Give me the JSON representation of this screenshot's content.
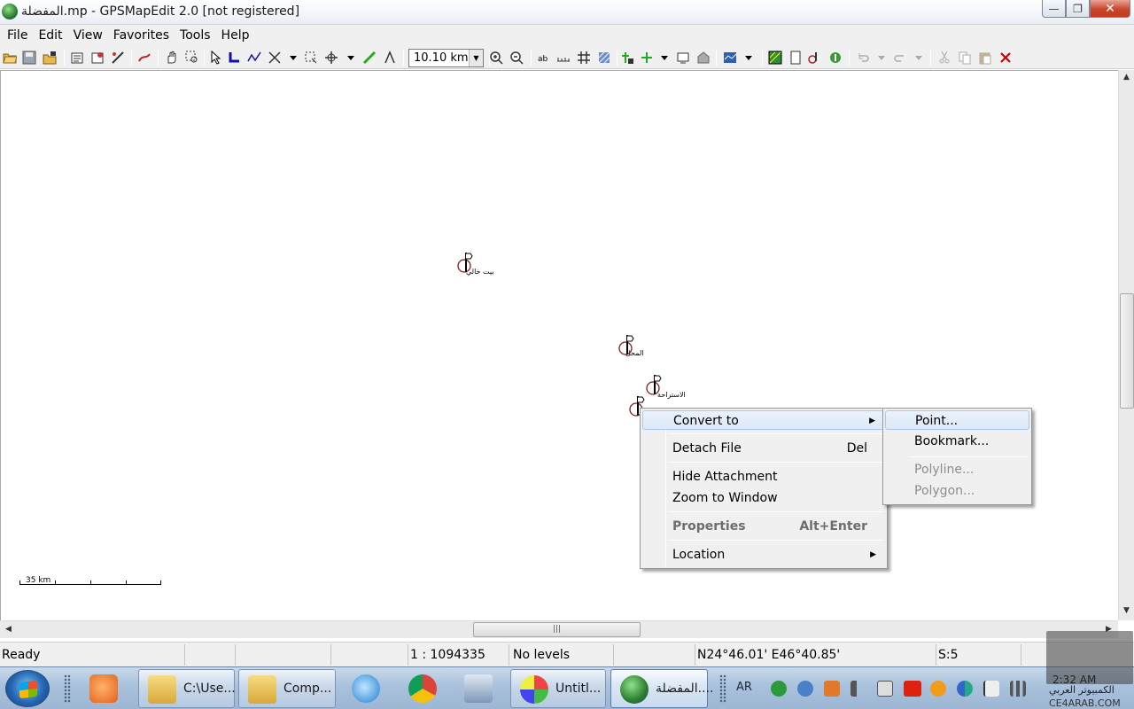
{
  "window": {
    "title": "المفضلة.mp - GPSMapEdit 2.0 [not registered]",
    "controls": {
      "minimize": "—",
      "maximize": "❐",
      "close": "✕"
    }
  },
  "menubar": [
    "File",
    "Edit",
    "View",
    "Favorites",
    "Tools",
    "Help"
  ],
  "toolbar": {
    "zoom_value": "10.10 km"
  },
  "map": {
    "pois": [
      {
        "label": "بيت خالي"
      },
      {
        "label": "المحل"
      },
      {
        "label": "الاستراحة"
      },
      {
        "label": ""
      }
    ],
    "scale_label": "35 km"
  },
  "context_menu": {
    "items": [
      {
        "label": "Convert to",
        "shortcut": "",
        "submenu": true
      },
      {
        "label": "Detach File",
        "shortcut": "Del",
        "submenu": false
      },
      {
        "label": "Hide Attachment",
        "shortcut": "",
        "submenu": false
      },
      {
        "label": "Zoom to Window",
        "shortcut": "",
        "submenu": false
      },
      {
        "label": "Properties",
        "shortcut": "Alt+Enter",
        "submenu": false
      },
      {
        "label": "Location",
        "shortcut": "",
        "submenu": true
      }
    ],
    "submenu_items": [
      {
        "label": "Point...",
        "enabled": true
      },
      {
        "label": "Bookmark...",
        "enabled": true
      },
      {
        "label": "Polyline...",
        "enabled": false
      },
      {
        "label": "Polygon...",
        "enabled": false
      }
    ]
  },
  "statusbar": {
    "state": "Ready",
    "scale": "1 : 1094335",
    "levels": "No levels",
    "coords": "N24°46.01' E46°40.85'",
    "selection": "S:5"
  },
  "taskbar": {
    "buttons": [
      {
        "label": "C:\\Use..."
      },
      {
        "label": "Comp..."
      },
      {
        "label": "Untitl..."
      },
      {
        "label": "المفضلة...."
      }
    ],
    "lang": "AR",
    "clock": "2:32 AM",
    "watermark_line1": "الكمبيوتر العربي",
    "watermark_line2": "CE4ARAB.COM"
  },
  "colors": {
    "highlight": "#dce9f8",
    "menu_bg": "#f0f0f0",
    "taskbar": "#a9c1dc"
  }
}
